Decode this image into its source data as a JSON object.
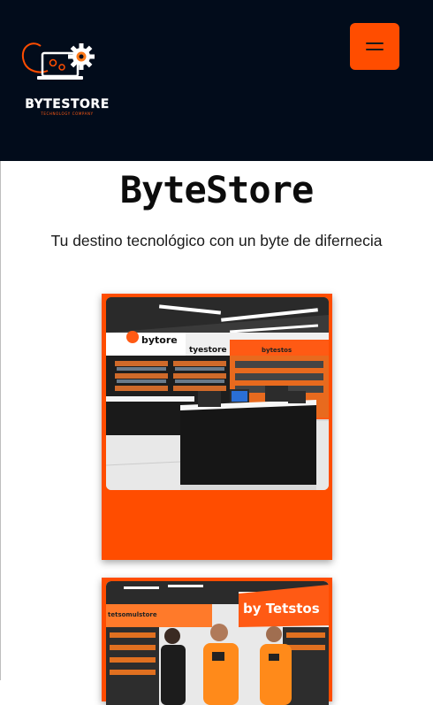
{
  "header": {
    "logo_title": "BYTESTORE",
    "logo_subtitle": "TECHNOLOGY COMPANY",
    "menu_icon": "hamburger-menu-icon",
    "background": "#020c1b",
    "accent": "#ff4d00"
  },
  "hero": {
    "title": "ByteStore",
    "subtitle": "Tu destino tecnológico con un byte de difernecia"
  },
  "cards": [
    {
      "image_icon": "store-interior-photo",
      "signs": [
        "bytore",
        "tyestore",
        "bytestos"
      ]
    },
    {
      "image_icon": "store-staff-photo",
      "signs": [
        "by Tetstos",
        "tetsomulstore"
      ]
    }
  ]
}
